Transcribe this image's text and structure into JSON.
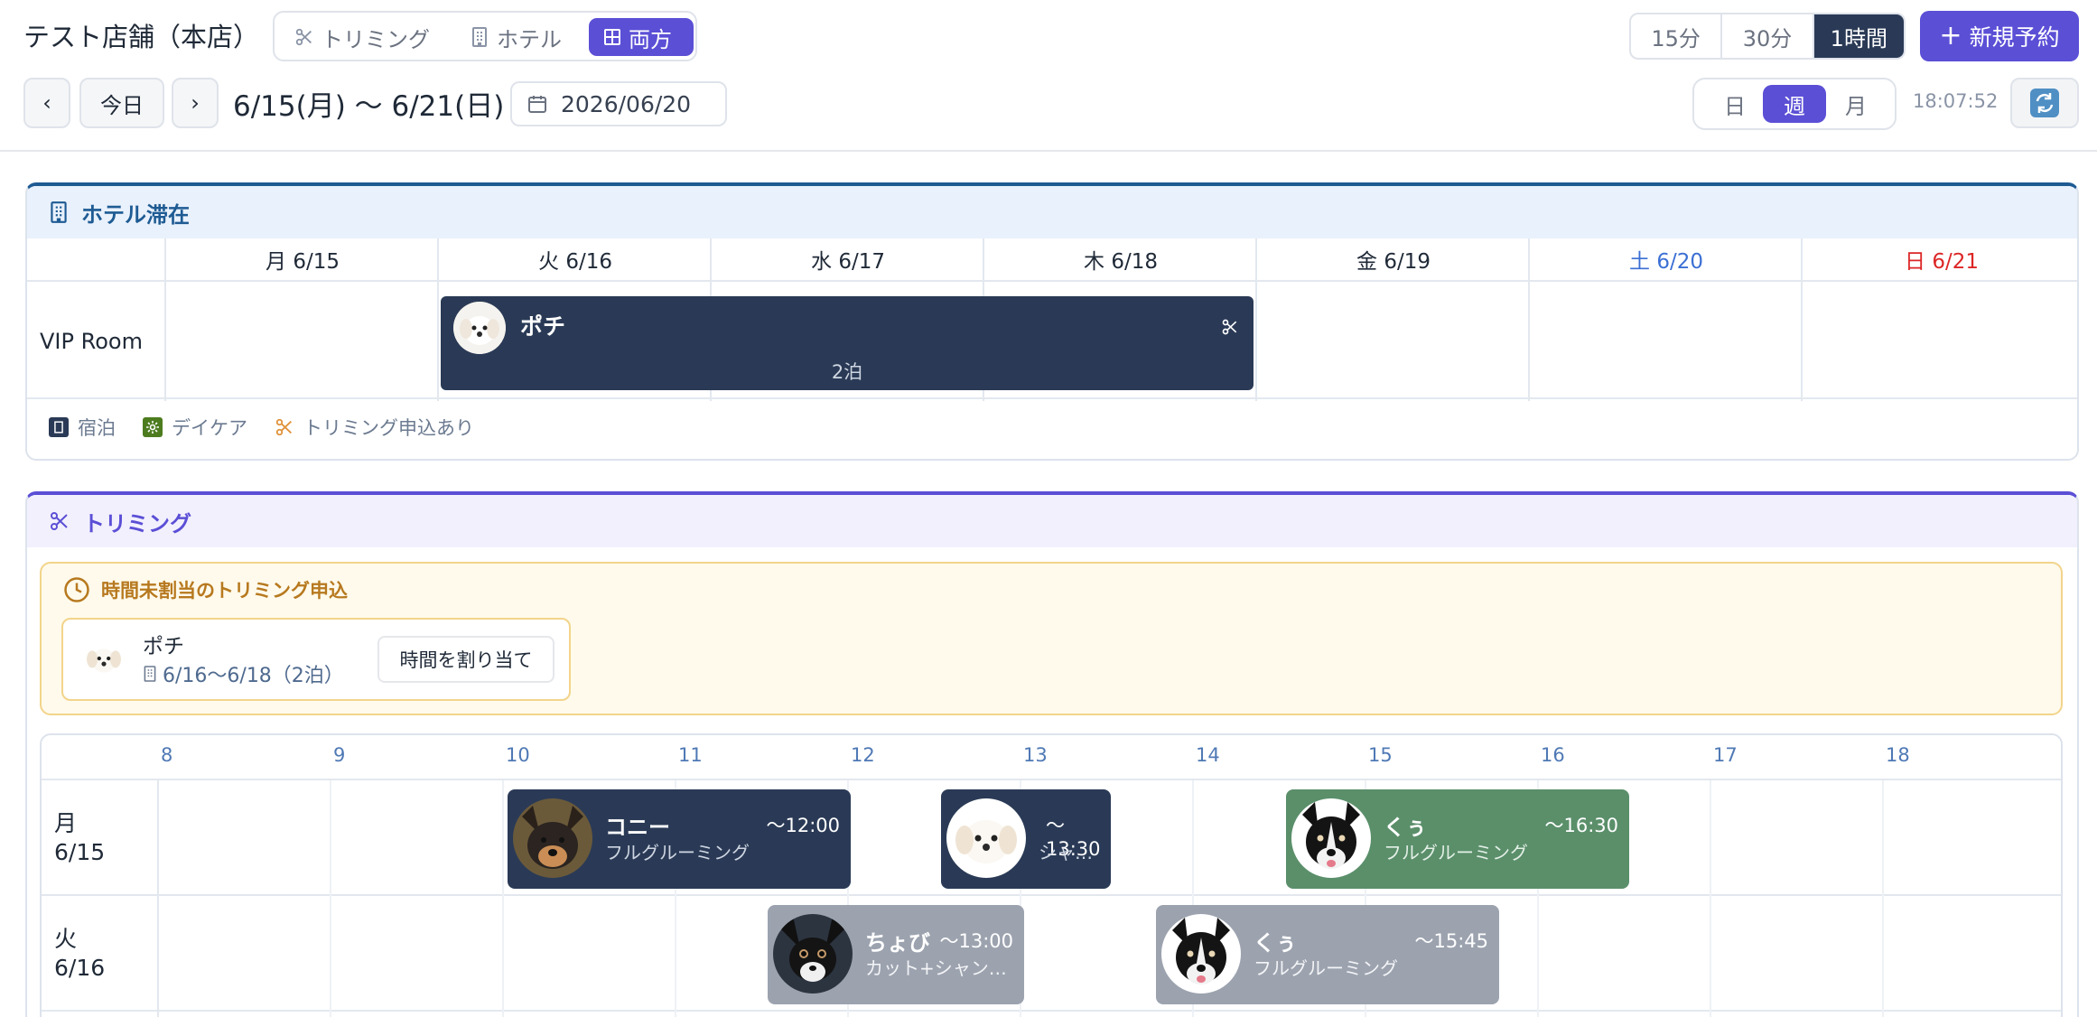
{
  "store": {
    "title": "テスト店舗（本店）"
  },
  "mode_tabs": [
    {
      "label": "トリミング",
      "icon": "scissors-icon"
    },
    {
      "label": "ホテル",
      "icon": "building-icon"
    },
    {
      "label": "両方",
      "icon": "grid-icon",
      "active": true
    }
  ],
  "intervals": [
    {
      "label": "15分"
    },
    {
      "label": "30分"
    },
    {
      "label": "1時間",
      "active": true
    }
  ],
  "new_button": {
    "label": "新規予約",
    "icon": "plus-icon"
  },
  "nav": {
    "prev": "‹",
    "today": "今日",
    "next": "›"
  },
  "range": "6/15(月) 〜 6/21(日)",
  "date_picker": {
    "value": "2026/06/20",
    "icon": "calendar-icon"
  },
  "views": [
    {
      "label": "日"
    },
    {
      "label": "週",
      "active": true
    },
    {
      "label": "月"
    }
  ],
  "clock": "18:07:52",
  "refresh": {
    "icon": "refresh-icon"
  },
  "hotel": {
    "title": "ホテル滞在",
    "days": [
      {
        "label": "月 6/15",
        "color": "#1f2937"
      },
      {
        "label": "火 6/16",
        "color": "#1f2937"
      },
      {
        "label": "水 6/17",
        "color": "#1f2937"
      },
      {
        "label": "木 6/18",
        "color": "#1f2937"
      },
      {
        "label": "金 6/19",
        "color": "#1f2937"
      },
      {
        "label": "土 6/20",
        "color": "#3b6fd4"
      },
      {
        "label": "日 6/21",
        "color": "#dc2626"
      }
    ],
    "room": "VIP Room",
    "stay": {
      "pet": "ポチ",
      "nights": "2泊",
      "icon": "scissors-icon"
    },
    "legend": [
      {
        "label": "宿泊",
        "color": "#2a3a56",
        "icon": "building-icon"
      },
      {
        "label": "デイケア",
        "color": "#4d7c1f",
        "icon": "sun-icon"
      },
      {
        "label": "トリミング申込あり",
        "color": "#e0923a",
        "icon": "scissors-icon"
      }
    ]
  },
  "trimming": {
    "title": "トリミング",
    "unassigned": {
      "title": "時間未割当のトリミング申込",
      "pet": "ポチ",
      "dates": "6/16〜6/18（2泊）",
      "assign_label": "時間を割り当て"
    },
    "hours": [
      "8",
      "9",
      "10",
      "11",
      "12",
      "13",
      "14",
      "15",
      "16",
      "17",
      "18"
    ],
    "rows": [
      {
        "day": "月",
        "date": "6/15"
      },
      {
        "day": "火",
        "date": "6/16"
      }
    ],
    "appointments": [
      {
        "row": 0,
        "pet": "コニー",
        "end": "〜12:00",
        "service": "フルグルーミング",
        "color": "#2a3a56",
        "dog": "shiba"
      },
      {
        "row": 0,
        "pet": "",
        "end": "〜13:30",
        "service": "シャ…",
        "color": "#2a3a56",
        "dog": "maltese"
      },
      {
        "row": 0,
        "pet": "くぅ",
        "end": "〜16:30",
        "service": "フルグルーミング",
        "color": "#5a8f6a",
        "dog": "collie"
      },
      {
        "row": 1,
        "pet": "ちょび",
        "end": "〜13:00",
        "service": "カット+シャン…",
        "color": "#9ca3af",
        "dog": "chihuahua"
      },
      {
        "row": 1,
        "pet": "くぅ",
        "end": "〜15:45",
        "service": "フルグルーミング",
        "color": "#9ca3af",
        "dog": "collie"
      }
    ]
  }
}
